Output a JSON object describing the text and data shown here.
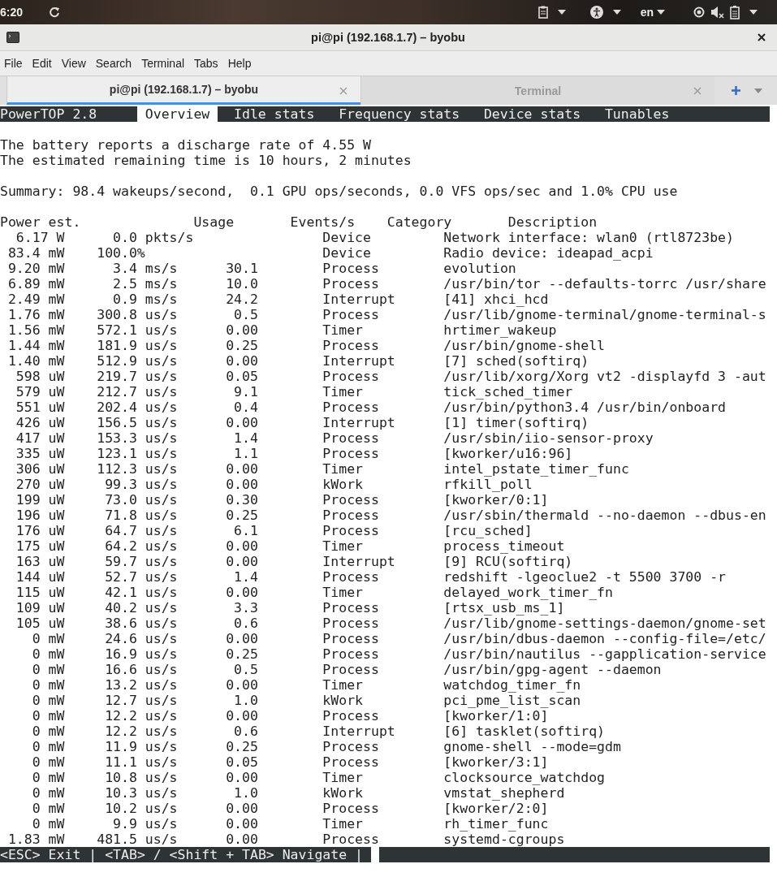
{
  "top_panel": {
    "clock": "6:20",
    "language": "en"
  },
  "window": {
    "title": "pi@pi (192.168.1.7) – byobu"
  },
  "menu": [
    "File",
    "Edit",
    "View",
    "Search",
    "Terminal",
    "Tabs",
    "Help"
  ],
  "terminal_tabs": [
    {
      "label": "pi@pi (192.168.1.7) – byobu",
      "selected": true
    },
    {
      "label": "Terminal",
      "selected": false
    }
  ],
  "powertop": {
    "title": "PowerTOP 2.8",
    "tabs": [
      {
        "label": "Overview",
        "selected": true
      },
      {
        "label": "Idle stats",
        "selected": false
      },
      {
        "label": "Frequency stats",
        "selected": false
      },
      {
        "label": "Device stats",
        "selected": false
      },
      {
        "label": "Tunables",
        "selected": false
      }
    ],
    "battery_lines": [
      "The battery reports a discharge rate of 4.55 W",
      "The estimated remaining time is 10 hours, 2 minutes"
    ],
    "summary": "Summary: 98.4 wakeups/second,  0.1 GPU ops/seconds, 0.0 VFS ops/sec and 1.0% CPU use",
    "columns": [
      "Power est.",
      "Usage",
      "Events/s",
      "Category",
      "Description"
    ],
    "rows": [
      {
        "power": "6.17 W",
        "usage": "0.0 pkts/s",
        "category": "Device",
        "description": "Network interface: wlan0 (rtl8723be)"
      },
      {
        "power": "83.4 mW",
        "usage": "100.0%",
        "category": "Device",
        "description": "Radio device: ideapad_acpi"
      },
      {
        "power": "9.20 mW",
        "usage": "3.4 ms/s",
        "events": "30.1",
        "category": "Process",
        "description": "evolution"
      },
      {
        "power": "6.89 mW",
        "usage": "2.5 ms/s",
        "events": "10.0",
        "category": "Process",
        "description": "/usr/bin/tor --defaults-torrc /usr/share"
      },
      {
        "power": "2.49 mW",
        "usage": "0.9 ms/s",
        "events": "24.2",
        "category": "Interrupt",
        "description": "[41] xhci_hcd"
      },
      {
        "power": "1.76 mW",
        "usage": "300.8 us/s",
        "events": "0.5",
        "category": "Process",
        "description": "/usr/lib/gnome-terminal/gnome-terminal-s"
      },
      {
        "power": "1.56 mW",
        "usage": "572.1 us/s",
        "events": "0.00",
        "category": "Timer",
        "description": "hrtimer_wakeup"
      },
      {
        "power": "1.44 mW",
        "usage": "181.9 us/s",
        "events": "0.25",
        "category": "Process",
        "description": "/usr/bin/gnome-shell"
      },
      {
        "power": "1.40 mW",
        "usage": "512.9 us/s",
        "events": "0.00",
        "category": "Interrupt",
        "description": "[7] sched(softirq)"
      },
      {
        "power": "598 uW",
        "usage": "219.7 us/s",
        "events": "0.05",
        "category": "Process",
        "description": "/usr/lib/xorg/Xorg vt2 -displayfd 3 -aut"
      },
      {
        "power": "579 uW",
        "usage": "212.7 us/s",
        "events": "9.1",
        "category": "Timer",
        "description": "tick_sched_timer"
      },
      {
        "power": "551 uW",
        "usage": "202.4 us/s",
        "events": "0.4",
        "category": "Process",
        "description": "/usr/bin/python3.4 /usr/bin/onboard"
      },
      {
        "power": "426 uW",
        "usage": "156.5 us/s",
        "events": "0.00",
        "category": "Interrupt",
        "description": "[1] timer(softirq)"
      },
      {
        "power": "417 uW",
        "usage": "153.3 us/s",
        "events": "1.4",
        "category": "Process",
        "description": "/usr/sbin/iio-sensor-proxy"
      },
      {
        "power": "335 uW",
        "usage": "123.1 us/s",
        "events": "1.1",
        "category": "Process",
        "description": "[kworker/u16:96]"
      },
      {
        "power": "306 uW",
        "usage": "112.3 us/s",
        "events": "0.00",
        "category": "Timer",
        "description": "intel_pstate_timer_func"
      },
      {
        "power": "270 uW",
        "usage": "99.3 us/s",
        "events": "0.00",
        "category": "kWork",
        "description": "rfkill_poll"
      },
      {
        "power": "199 uW",
        "usage": "73.0 us/s",
        "events": "0.30",
        "category": "Process",
        "description": "[kworker/0:1]"
      },
      {
        "power": "196 uW",
        "usage": "71.8 us/s",
        "events": "0.25",
        "category": "Process",
        "description": "/usr/sbin/thermald --no-daemon --dbus-en"
      },
      {
        "power": "176 uW",
        "usage": "64.7 us/s",
        "events": "6.1",
        "category": "Process",
        "description": "[rcu_sched]"
      },
      {
        "power": "175 uW",
        "usage": "64.2 us/s",
        "events": "0.00",
        "category": "Timer",
        "description": "process_timeout"
      },
      {
        "power": "163 uW",
        "usage": "59.7 us/s",
        "events": "0.00",
        "category": "Interrupt",
        "description": "[9] RCU(softirq)"
      },
      {
        "power": "144 uW",
        "usage": "52.7 us/s",
        "events": "1.4",
        "category": "Process",
        "description": "redshift -lgeoclue2 -t 5500 3700 -r"
      },
      {
        "power": "115 uW",
        "usage": "42.1 us/s",
        "events": "0.00",
        "category": "Timer",
        "description": "delayed_work_timer_fn"
      },
      {
        "power": "109 uW",
        "usage": "40.2 us/s",
        "events": "3.3",
        "category": "Process",
        "description": "[rtsx_usb_ms_1]"
      },
      {
        "power": "105 uW",
        "usage": "38.6 us/s",
        "events": "0.6",
        "category": "Process",
        "description": "/usr/lib/gnome-settings-daemon/gnome-set"
      },
      {
        "power": "0 mW",
        "usage": "24.6 us/s",
        "events": "0.00",
        "category": "Process",
        "description": "/usr/bin/dbus-daemon --config-file=/etc/"
      },
      {
        "power": "0 mW",
        "usage": "16.9 us/s",
        "events": "0.25",
        "category": "Process",
        "description": "/usr/bin/nautilus --gapplication-service"
      },
      {
        "power": "0 mW",
        "usage": "16.6 us/s",
        "events": "0.5",
        "category": "Process",
        "description": "/usr/bin/gpg-agent --daemon"
      },
      {
        "power": "0 mW",
        "usage": "13.2 us/s",
        "events": "0.00",
        "category": "Timer",
        "description": "watchdog_timer_fn"
      },
      {
        "power": "0 mW",
        "usage": "12.7 us/s",
        "events": "1.0",
        "category": "kWork",
        "description": "pci_pme_list_scan"
      },
      {
        "power": "0 mW",
        "usage": "12.2 us/s",
        "events": "0.00",
        "category": "Process",
        "description": "[kworker/1:0]"
      },
      {
        "power": "0 mW",
        "usage": "12.2 us/s",
        "events": "0.6",
        "category": "Interrupt",
        "description": "[6] tasklet(softirq)"
      },
      {
        "power": "0 mW",
        "usage": "11.9 us/s",
        "events": "0.25",
        "category": "Process",
        "description": "gnome-shell --mode=gdm"
      },
      {
        "power": "0 mW",
        "usage": "11.1 us/s",
        "events": "0.05",
        "category": "Process",
        "description": "[kworker/3:1]"
      },
      {
        "power": "0 mW",
        "usage": "10.8 us/s",
        "events": "0.00",
        "category": "Timer",
        "description": "clocksource_watchdog"
      },
      {
        "power": "0 mW",
        "usage": "10.3 us/s",
        "events": "1.0",
        "category": "kWork",
        "description": "vmstat_shepherd"
      },
      {
        "power": "0 mW",
        "usage": "10.2 us/s",
        "events": "0.00",
        "category": "Process",
        "description": "[kworker/2:0]"
      },
      {
        "power": "0 mW",
        "usage": "9.9 us/s",
        "events": "0.00",
        "category": "Timer",
        "description": "rh_timer_func"
      },
      {
        "power": "1.83 mW",
        "usage": "481.5 us/s",
        "events": "0.00",
        "category": "Process",
        "description": "systemd-cgroups"
      }
    ],
    "status_line": "<ESC> Exit | <TAB> / <Shift + TAB> Navigate |"
  }
}
